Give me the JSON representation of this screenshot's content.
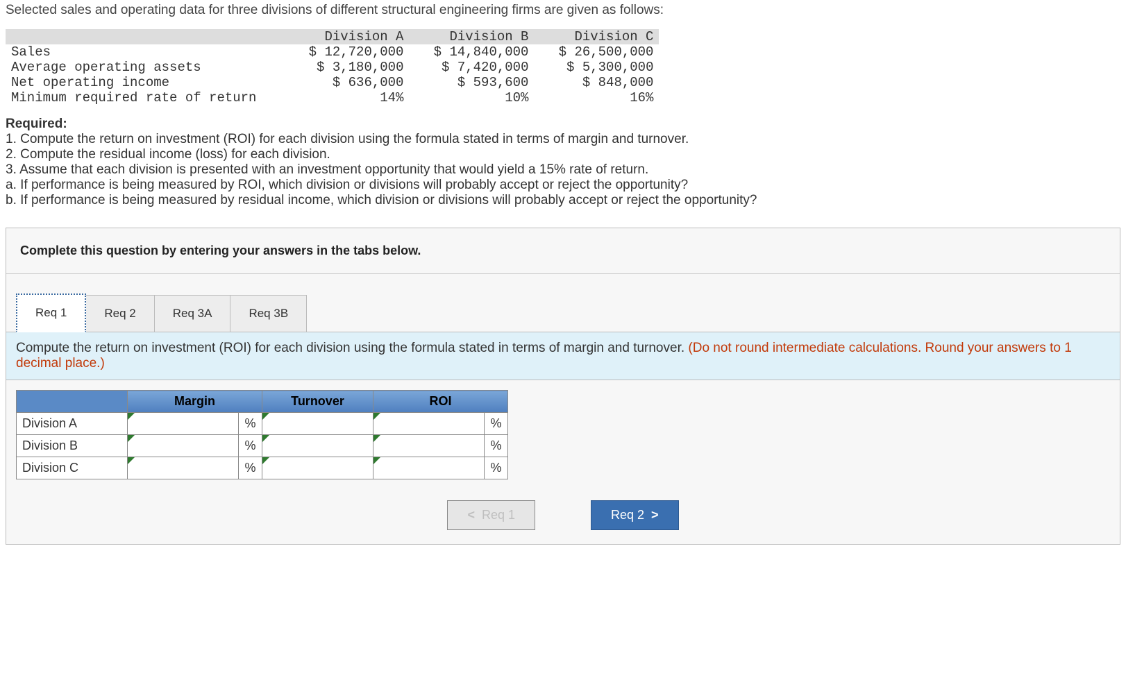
{
  "intro": "Selected sales and operating data for three divisions of different structural engineering firms are given as follows:",
  "data_table": {
    "headers": [
      "",
      "Division A",
      "Division B",
      "Division C"
    ],
    "rows": [
      {
        "label": "Sales",
        "a": "$ 12,720,000",
        "b": "$ 14,840,000",
        "c": "$ 26,500,000"
      },
      {
        "label": "Average operating assets",
        "a": "$ 3,180,000",
        "b": "$ 7,420,000",
        "c": "$ 5,300,000"
      },
      {
        "label": "Net operating income",
        "a": "$ 636,000",
        "b": "$ 593,600",
        "c": "$ 848,000"
      },
      {
        "label": "Minimum required rate of return",
        "a": "14%",
        "b": "10%",
        "c": "16%"
      }
    ]
  },
  "required": {
    "title": "Required:",
    "items": [
      "1. Compute the return on investment (ROI) for each division using the formula stated in terms of margin and turnover.",
      "2. Compute the residual income (loss) for each division.",
      "3. Assume that each division is presented with an investment opportunity that would yield a 15% rate of return.",
      "a. If performance is being measured by ROI, which division or divisions will probably accept or reject the opportunity?",
      "b. If performance is being measured by residual income, which division or divisions will probably accept or reject the opportunity?"
    ]
  },
  "instruction": "Complete this question by entering your answers in the tabs below.",
  "tabs": {
    "items": [
      {
        "label": "Req 1",
        "active": true
      },
      {
        "label": "Req 2",
        "active": false
      },
      {
        "label": "Req 3A",
        "active": false
      },
      {
        "label": "Req 3B",
        "active": false
      }
    ]
  },
  "tab_content": {
    "text": "Compute the return on investment (ROI) for each division using the formula stated in terms of margin and turnover. ",
    "hint": "(Do not round intermediate calculations. Round your answers to 1 decimal place.)"
  },
  "answer_table": {
    "headers": [
      "",
      "Margin",
      "Turnover",
      "ROI"
    ],
    "unit_pct": "%",
    "rows": [
      {
        "label": "Division A"
      },
      {
        "label": "Division B"
      },
      {
        "label": "Division C"
      }
    ]
  },
  "nav": {
    "prev_label": "Req 1",
    "next_label": "Req 2"
  }
}
